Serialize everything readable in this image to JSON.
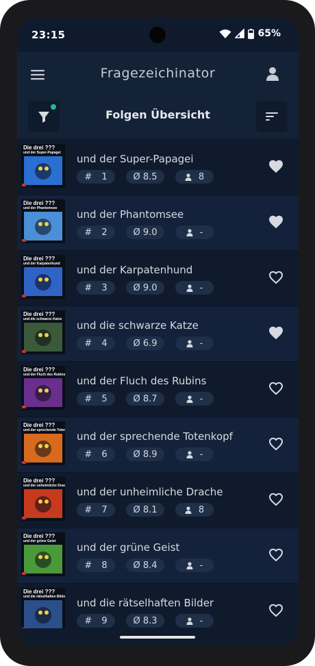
{
  "status_bar": {
    "time": "23:15",
    "battery_percent": "65%"
  },
  "app_bar": {
    "title": "Fragezeichinator",
    "menu_icon": "menu-icon",
    "account_icon": "account-icon"
  },
  "sub_bar": {
    "title": "Folgen Übersicht",
    "filter_icon": "filter-icon",
    "filter_active": true,
    "sort_icon": "sort-icon"
  },
  "colors": {
    "background": "#0f1a2d",
    "bar": "#142238",
    "chip": "#1f2f48",
    "accent_dot": "#1fb996",
    "text": "#d6dae0"
  },
  "cover_brand": "Die drei ???",
  "rating_prefix": "Ø",
  "episodes": [
    {
      "number": "1",
      "title": "und der Super-Papagei",
      "rating": "8.5",
      "votes": "8",
      "favorite": true,
      "cover_subtitle": "und der Super-Papagei",
      "cover_color": "#2a6fd1"
    },
    {
      "number": "2",
      "title": "und der Phantomsee",
      "rating": "9.0",
      "votes": "-",
      "favorite": true,
      "cover_subtitle": "und der Phantomsee",
      "cover_color": "#4a8fd8"
    },
    {
      "number": "3",
      "title": "und der Karpatenhund",
      "rating": "9.0",
      "votes": "-",
      "favorite": false,
      "cover_subtitle": "und der Karpatenhund",
      "cover_color": "#2f63c8"
    },
    {
      "number": "4",
      "title": "und die schwarze Katze",
      "rating": "6.9",
      "votes": "-",
      "favorite": true,
      "cover_subtitle": "und die schwarze Katze",
      "cover_color": "#3a5a3a"
    },
    {
      "number": "5",
      "title": "und der Fluch des Rubins",
      "rating": "8.7",
      "votes": "-",
      "favorite": false,
      "cover_subtitle": "und der Fluch des Rubins",
      "cover_color": "#6a2f8c"
    },
    {
      "number": "6",
      "title": "und der sprechende Totenkopf",
      "rating": "8.9",
      "votes": "-",
      "favorite": false,
      "cover_subtitle": "und der sprechende Totenkopf",
      "cover_color": "#d86a1e"
    },
    {
      "number": "7",
      "title": "und der unheimliche Drache",
      "rating": "8.1",
      "votes": "8",
      "favorite": false,
      "cover_subtitle": "und der unheimliche Drache",
      "cover_color": "#c63a1e"
    },
    {
      "number": "8",
      "title": "und der grüne Geist",
      "rating": "8.4",
      "votes": "-",
      "favorite": false,
      "cover_subtitle": "und der grüne Geist",
      "cover_color": "#4a9a3a"
    },
    {
      "number": "9",
      "title": "und die rätselhaften Bilder",
      "rating": "8.3",
      "votes": "-",
      "favorite": false,
      "cover_subtitle": "und die rätselhaften Bilder",
      "cover_color": "#2a4f8a"
    }
  ]
}
